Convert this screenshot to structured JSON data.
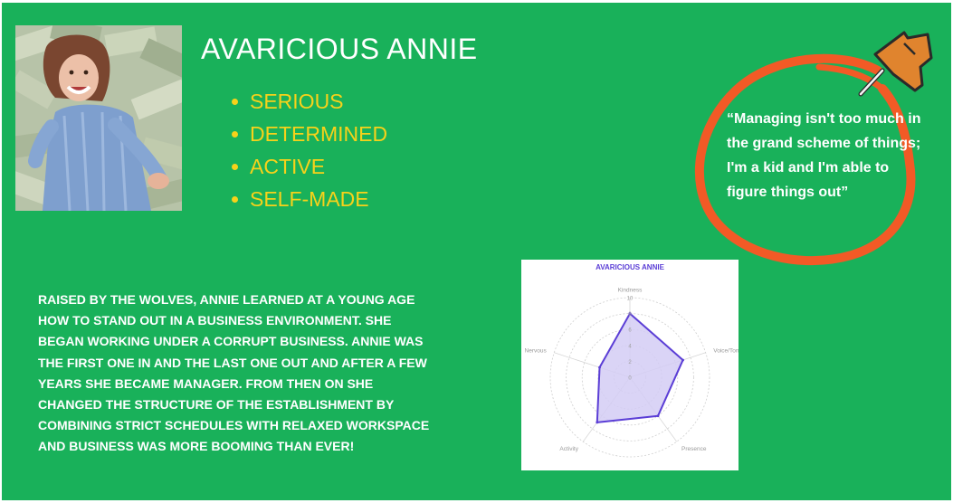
{
  "character": {
    "name": "AVARICIOUS ANNIE",
    "traits": [
      "SERIOUS",
      "DETERMINED",
      "ACTIVE",
      "SELF-MADE"
    ],
    "quote": "“Managing isn't too much in the grand scheme of things; I'm a kid and I'm able to figure things out”",
    "bio": "RAISED BY THE WOLVES, ANNIE LEARNED AT A YOUNG AGE HOW TO STAND OUT IN A BUSINESS ENVIRONMENT. SHE BEGAN WORKING UNDER A CORRUPT BUSINESS. ANNIE WAS THE FIRST ONE IN AND THE LAST ONE OUT AND AFTER A FEW YEARS SHE BECAME MANAGER. FROM THEN ON SHE CHANGED THE STRUCTURE OF THE ESTABLISHMENT BY COMBINING STRICT SCHEDULES WITH RELAXED WORKSPACE AND BUSINESS WAS MORE BOOMING THAN EVER!"
  },
  "icons": {
    "pin": "pushpin-icon",
    "photo": "woman-lying-in-money"
  },
  "colors": {
    "background": "#19b15a",
    "trait_text": "#f7d21a",
    "circle_stroke": "#f25a26",
    "pin": "#e0842e",
    "series": "#5b3ed6",
    "series_fill": "#d3ccf4"
  },
  "chart_data": {
    "type": "radar",
    "title": "AVARICIOUS ANNIE",
    "axes": [
      "Kindness",
      "Voice/Tone",
      "Presence",
      "Activity",
      "Nervous"
    ],
    "range": [
      0,
      10
    ],
    "ticks": [
      0,
      2,
      4,
      6,
      8,
      10
    ],
    "values": [
      8,
      7,
      6,
      7,
      4
    ],
    "grid": true
  }
}
